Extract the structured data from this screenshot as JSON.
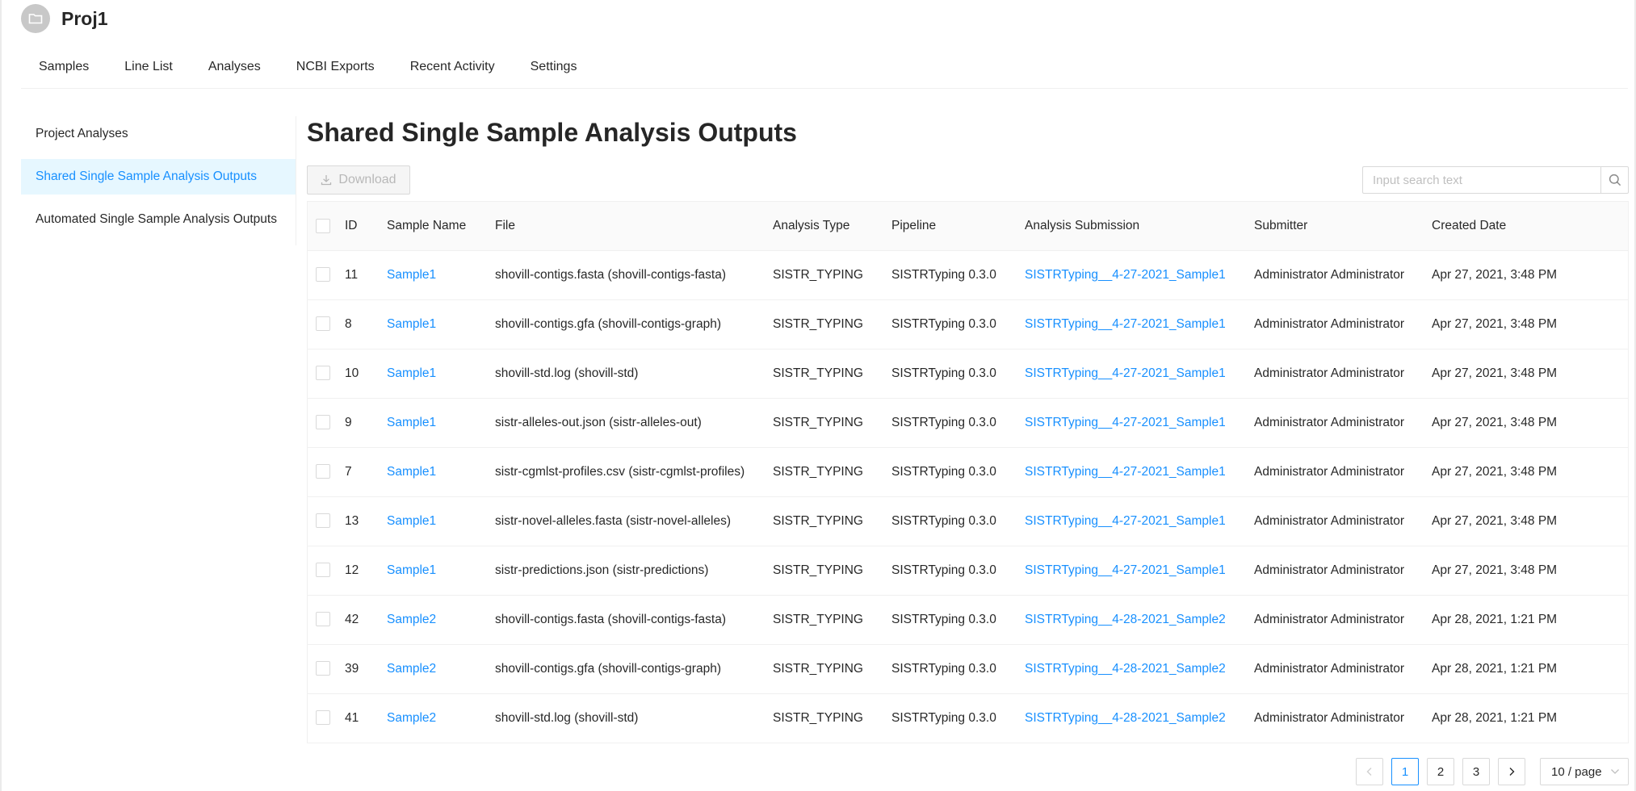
{
  "project": {
    "title": "Proj1",
    "icon": "folder-icon"
  },
  "topnav": [
    "Samples",
    "Line List",
    "Analyses",
    "NCBI Exports",
    "Recent Activity",
    "Settings"
  ],
  "sidemenu": {
    "items": [
      "Project Analyses",
      "Shared Single Sample Analysis Outputs",
      "Automated Single Sample Analysis Outputs"
    ],
    "active": "Shared Single Sample Analysis Outputs"
  },
  "main": {
    "title": "Shared Single Sample Analysis Outputs"
  },
  "toolbar": {
    "download_label": "Download",
    "download_icon": "download-icon",
    "search_placeholder": "Input search text",
    "search_icon": "search-icon"
  },
  "table": {
    "columns": [
      "ID",
      "Sample Name",
      "File",
      "Analysis Type",
      "Pipeline",
      "Analysis Submission",
      "Submitter",
      "Created Date"
    ],
    "rows": [
      {
        "id": "11",
        "sample": "Sample1",
        "file": "shovill-contigs.fasta (shovill-contigs-fasta)",
        "type": "SISTR_TYPING",
        "pipeline": "SISTRTyping 0.3.0",
        "submission": "SISTRTyping__4-27-2021_Sample1",
        "submitter": "Administrator Administrator",
        "created": "Apr 27, 2021, 3:48 PM"
      },
      {
        "id": "8",
        "sample": "Sample1",
        "file": "shovill-contigs.gfa (shovill-contigs-graph)",
        "type": "SISTR_TYPING",
        "pipeline": "SISTRTyping 0.3.0",
        "submission": "SISTRTyping__4-27-2021_Sample1",
        "submitter": "Administrator Administrator",
        "created": "Apr 27, 2021, 3:48 PM"
      },
      {
        "id": "10",
        "sample": "Sample1",
        "file": "shovill-std.log (shovill-std)",
        "type": "SISTR_TYPING",
        "pipeline": "SISTRTyping 0.3.0",
        "submission": "SISTRTyping__4-27-2021_Sample1",
        "submitter": "Administrator Administrator",
        "created": "Apr 27, 2021, 3:48 PM"
      },
      {
        "id": "9",
        "sample": "Sample1",
        "file": "sistr-alleles-out.json (sistr-alleles-out)",
        "type": "SISTR_TYPING",
        "pipeline": "SISTRTyping 0.3.0",
        "submission": "SISTRTyping__4-27-2021_Sample1",
        "submitter": "Administrator Administrator",
        "created": "Apr 27, 2021, 3:48 PM"
      },
      {
        "id": "7",
        "sample": "Sample1",
        "file": "sistr-cgmlst-profiles.csv (sistr-cgmlst-profiles)",
        "type": "SISTR_TYPING",
        "pipeline": "SISTRTyping 0.3.0",
        "submission": "SISTRTyping__4-27-2021_Sample1",
        "submitter": "Administrator Administrator",
        "created": "Apr 27, 2021, 3:48 PM"
      },
      {
        "id": "13",
        "sample": "Sample1",
        "file": "sistr-novel-alleles.fasta (sistr-novel-alleles)",
        "type": "SISTR_TYPING",
        "pipeline": "SISTRTyping 0.3.0",
        "submission": "SISTRTyping__4-27-2021_Sample1",
        "submitter": "Administrator Administrator",
        "created": "Apr 27, 2021, 3:48 PM"
      },
      {
        "id": "12",
        "sample": "Sample1",
        "file": "sistr-predictions.json (sistr-predictions)",
        "type": "SISTR_TYPING",
        "pipeline": "SISTRTyping 0.3.0",
        "submission": "SISTRTyping__4-27-2021_Sample1",
        "submitter": "Administrator Administrator",
        "created": "Apr 27, 2021, 3:48 PM"
      },
      {
        "id": "42",
        "sample": "Sample2",
        "file": "shovill-contigs.fasta (shovill-contigs-fasta)",
        "type": "SISTR_TYPING",
        "pipeline": "SISTRTyping 0.3.0",
        "submission": "SISTRTyping__4-28-2021_Sample2",
        "submitter": "Administrator Administrator",
        "created": "Apr 28, 2021, 1:21 PM"
      },
      {
        "id": "39",
        "sample": "Sample2",
        "file": "shovill-contigs.gfa (shovill-contigs-graph)",
        "type": "SISTR_TYPING",
        "pipeline": "SISTRTyping 0.3.0",
        "submission": "SISTRTyping__4-28-2021_Sample2",
        "submitter": "Administrator Administrator",
        "created": "Apr 28, 2021, 1:21 PM"
      },
      {
        "id": "41",
        "sample": "Sample2",
        "file": "shovill-std.log (shovill-std)",
        "type": "SISTR_TYPING",
        "pipeline": "SISTRTyping 0.3.0",
        "submission": "SISTRTyping__4-28-2021_Sample2",
        "submitter": "Administrator Administrator",
        "created": "Apr 28, 2021, 1:21 PM"
      }
    ]
  },
  "pagination": {
    "pages": [
      "1",
      "2",
      "3"
    ],
    "current": "1",
    "page_size": "10 / page",
    "prev_icon": "chevron-left-icon",
    "next_icon": "chevron-right-icon"
  },
  "colors": {
    "accent": "#1890ff",
    "active_bg": "#e6f7ff",
    "header_bg": "#fafafa",
    "border": "#f0f0f0"
  }
}
